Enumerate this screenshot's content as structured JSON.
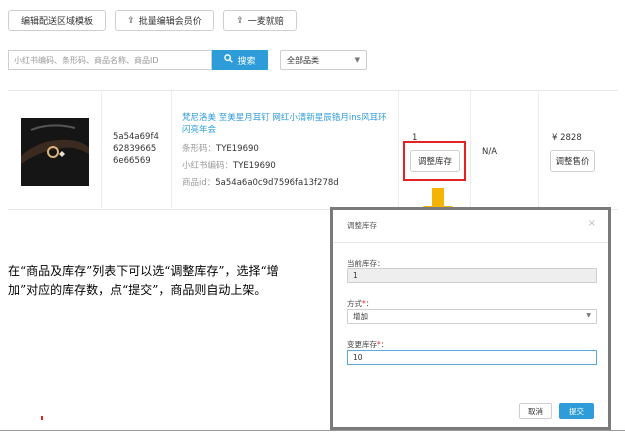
{
  "toolbar": {
    "batch_edit_region_label": "编辑配送区域模板",
    "batch_edit_member_price_label": "批量编辑会员价",
    "compensation_label": "一麦就赔",
    "upload_icon": "upload-icon"
  },
  "search": {
    "placeholder": "小红书编码、条形码、商品名称、商品ID",
    "button_label": "搜索",
    "category_selected": "全部品类"
  },
  "product": {
    "id_line1": "5a54a69f4",
    "id_line2": "62839665",
    "id_line3": "6e66569",
    "title": "梵尼洛美 至美星月耳钉 网红小清新星辰锆月ins风耳环闪亮年会",
    "barcode_label": "条形码：",
    "barcode_value": "TYE19690",
    "rb_code_label": "小红书编码：",
    "rb_code_value": "TYE19690",
    "item_id_label": "商品id：",
    "item_id_value": "5a54a6a0c9d7596fa13f278d",
    "stock": "1",
    "adjust_stock_label": "调整库存",
    "member_price": "N/A",
    "price": "¥ 2828",
    "adjust_price_label": "调整售价"
  },
  "modal": {
    "title": "调整库存",
    "current_stock_label": "当前库存：",
    "current_stock_value": "1",
    "method_label": "方式",
    "method_value": "增加",
    "change_label": "变更库存",
    "change_value": "10",
    "cancel_label": "取消",
    "submit_label": "提交"
  },
  "annotation": {
    "text": "在“商品及库存”列表下可以选“调整库存”，选择“增加”对应的库存数，点“提交”，商品则自动上架。"
  },
  "colors": {
    "accent": "#2d9cd8",
    "highlight": "#e52222",
    "arrow": "#f5b400"
  }
}
